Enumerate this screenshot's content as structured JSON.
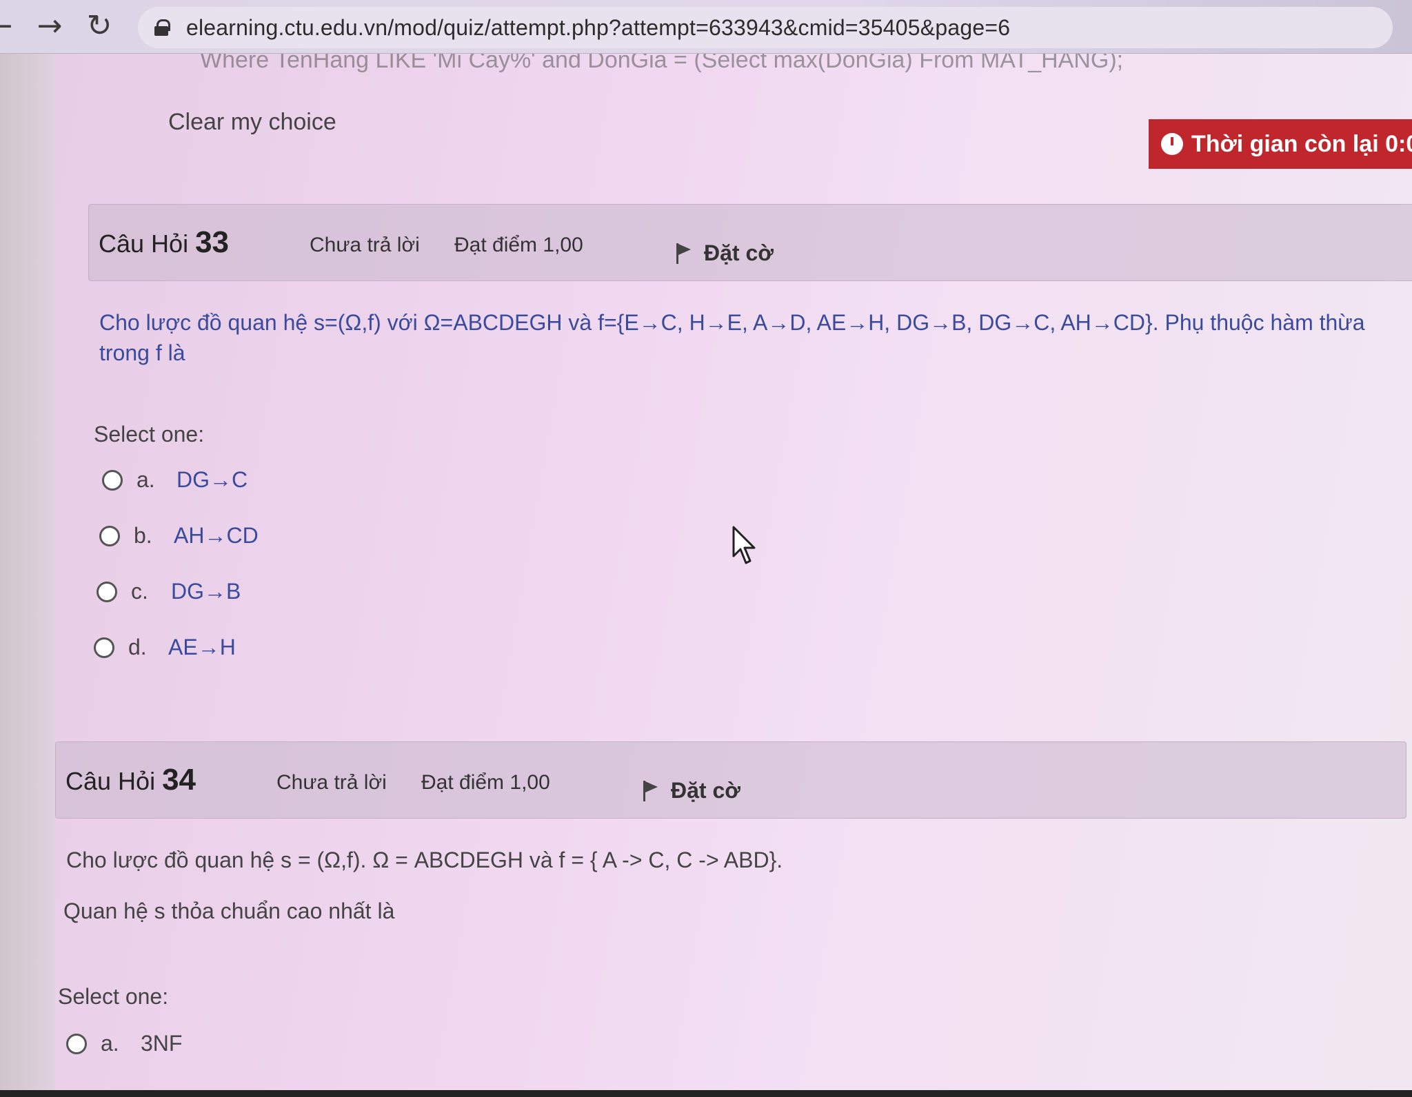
{
  "browser": {
    "back_glyph": "←",
    "forward_glyph": "→",
    "reload_glyph": "↻",
    "url": "elearning.ctu.edu.vn/mod/quiz/attempt.php?attempt=633943&cmid=35405&page=6"
  },
  "page": {
    "cut_off_text": "Where TenHang LIKE 'Mi Cay%' and DonGia = (Select max(DonGia) From MAT_HANG);",
    "clear_choice_label": "Clear my choice",
    "timer_text": "Thời gian còn lại 0:0"
  },
  "questions": [
    {
      "label": "Câu Hỏi",
      "number": "33",
      "state": "Chưa trả lời",
      "grade": "Đạt điểm 1,00",
      "flag_label": "Đặt cờ",
      "text_line1": "Cho lược đồ quan hệ s=(Ω,f) với Ω=ABCDEGH và f={E→C, H→E, A→D, AE→H, DG→B, DG→C, AH→CD}. Phụ thuộc hàm thừa",
      "text_line2": "trong f là",
      "select_one": "Select one:",
      "options": [
        {
          "letter": "a.",
          "text": "DG→C"
        },
        {
          "letter": "b.",
          "text": "AH→CD"
        },
        {
          "letter": "c.",
          "text": "DG→B"
        },
        {
          "letter": "d.",
          "text": "AE→H"
        }
      ]
    },
    {
      "label": "Câu Hỏi",
      "number": "34",
      "state": "Chưa trả lời",
      "grade": "Đạt điểm 1,00",
      "flag_label": "Đặt cờ",
      "text_line1": "Cho lược đồ quan hệ s = (Ω,f). Ω = ABCDEGH và f = { A -> C, C -> ABD}.",
      "text_line2": "Quan hệ s thỏa chuẩn cao nhất là",
      "select_one": "Select one:",
      "options": [
        {
          "letter": "a.",
          "text": "3NF"
        }
      ]
    }
  ],
  "colors": {
    "timer_bg": "#c0272d",
    "question_text": "#3a4a9c"
  }
}
